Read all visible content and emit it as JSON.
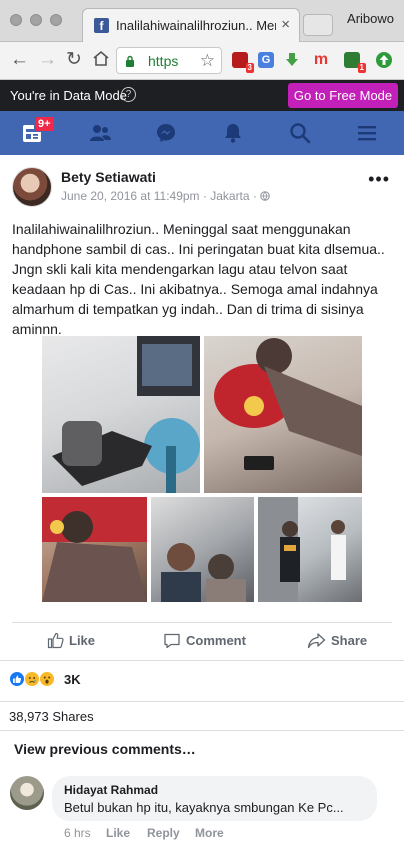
{
  "browser": {
    "tab_title": "Inalilahiwainalilhroziun.. Meni",
    "tab_favicon": "f",
    "tab_close": "×",
    "profile_name": "Aribowo",
    "url": "https",
    "extensions": [
      {
        "name": "ublock-icon",
        "label": "",
        "badge": "3",
        "color": "#b71c1c"
      },
      {
        "name": "translate-icon",
        "label": "G",
        "badge": "",
        "color": "#4a7fe0"
      },
      {
        "name": "download-arrow-icon",
        "label": "",
        "badge": "",
        "color": "#43a047"
      },
      {
        "name": "m-extension-icon",
        "label": "m",
        "badge": "",
        "color": "#e53935"
      },
      {
        "name": "green-extension-icon",
        "label": "",
        "badge": "1",
        "color": "#2e7d32"
      },
      {
        "name": "upload-icon",
        "label": "",
        "badge": "",
        "color": "#2e9b3a"
      }
    ]
  },
  "data_mode": {
    "text": "You're in Data Mode",
    "help": "?",
    "button": "Go to Free Mode"
  },
  "fb_nav": {
    "notification_badge": "9+",
    "items": [
      "news-feed-icon",
      "friends-icon",
      "messenger-icon",
      "notifications-bell-icon",
      "search-icon",
      "menu-icon"
    ]
  },
  "post": {
    "author": "Bety Setiawati",
    "meta": "June 20, 2016 at 11:49pm · Jakarta · ",
    "more": "•••",
    "text": "Inalilahiwainalilhroziun.. Meninggal saat menggunakan handphone sambil di cas.. Ini peringatan buat kita dlsemua.. Jngn skli kali kita mendengarkan lagu atau telvon saat keadaan hp di Cas.. Ini akibatnya.. Semoga amal indahnya almarhum di tempatkan yg indah.. Dan di trima di sisinya aminnn.",
    "actions": {
      "like": "Like",
      "comment": "Comment",
      "share": "Share"
    },
    "reactions_count": "3K",
    "reaction_colors": [
      "#1877f2",
      "#f7b928",
      "#f7b928"
    ],
    "shares": "38,973 Shares"
  },
  "comments": {
    "view_previous": "View previous comments…",
    "items": [
      {
        "name": "Hidayat Rahmad",
        "text": "Betul bukan hp itu, kayaknya smbungan Ke Pc...",
        "time": "6 hrs",
        "like": "Like",
        "reply": "Reply",
        "more": "More"
      }
    ]
  }
}
